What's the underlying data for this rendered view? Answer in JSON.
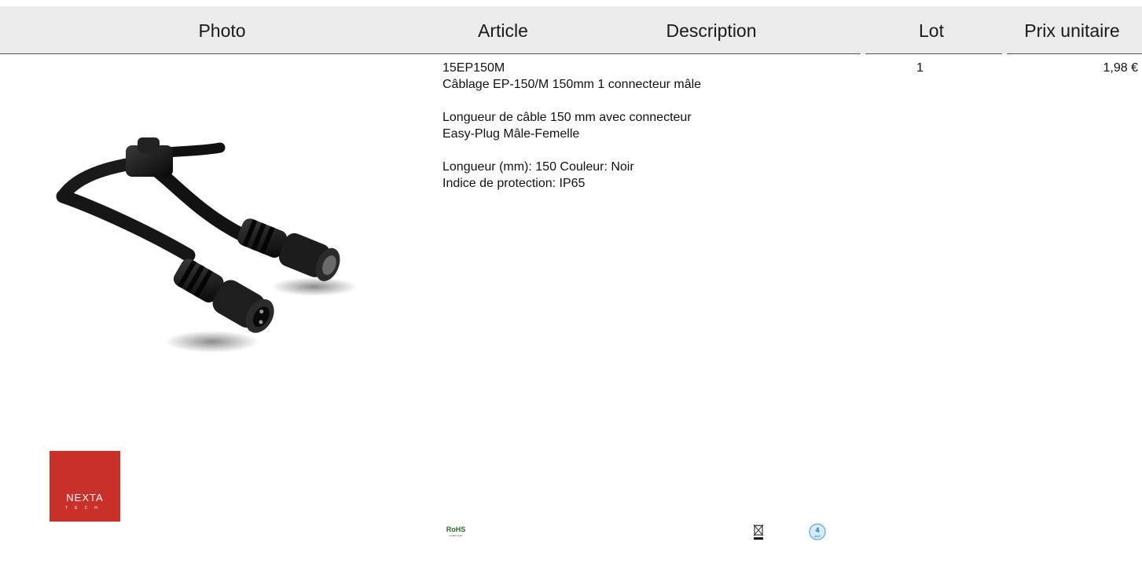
{
  "table": {
    "headers": {
      "photo": "Photo",
      "article": "Article",
      "description": "Description",
      "lot": "Lot",
      "unit_price": "Prix unitaire"
    },
    "row": {
      "article_code": "15EP150M",
      "article_name": "Câblage EP-150/M 150mm 1 connecteur mâle",
      "desc_line1": "Longueur de câble 150 mm avec connecteur",
      "desc_line2": "Easy-Plug Mâle-Femelle",
      "spec_line1": "Longueur (mm): 150 Couleur: Noir",
      "spec_line2": "Indice de protection: IP65",
      "lot": "1",
      "unit_price": "1,98 €"
    }
  },
  "brand": {
    "logo_text": "NEXTA",
    "logo_subtext": "TECH",
    "color": "#c9302a"
  },
  "certifications": {
    "rohs_text": "RoHS",
    "rohs_sub": "COMPLIANT",
    "warranty_text": "4",
    "warranty_sub": "ANS",
    "icons": [
      "rohs-icon",
      "weee-bin-icon",
      "warranty-badge-icon"
    ]
  }
}
